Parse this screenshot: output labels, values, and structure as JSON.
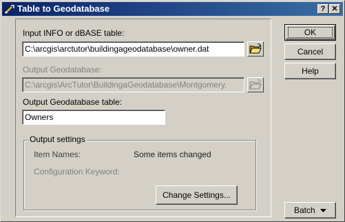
{
  "window": {
    "title": "Table to Geodatabase",
    "help_glyph": "?",
    "close_glyph": "✕"
  },
  "form": {
    "input_label": "Input INFO or dBASE table:",
    "input_value": "C:\\arcgis\\arctutor\\buildingageodatabase\\owner.dat",
    "output_gdb_label": "Output Geodatabase:",
    "output_gdb_value": "C:\\arcgis\\ArcTutor\\BuildingaGeodatabase\\Montgomery.",
    "output_table_label": "Output Geodatabase table:",
    "output_table_value": "Owners"
  },
  "output_settings": {
    "legend": "Output settings",
    "item_names_label": "Item Names:",
    "item_names_value": "Some items changed",
    "config_keyword_label": "Configuration Keyword:",
    "change_settings_label": "Change Settings..."
  },
  "buttons": {
    "ok": "OK",
    "cancel": "Cancel",
    "help": "Help",
    "batch": "Batch"
  },
  "icons": {
    "title_icon": "arcmap-tool-icon",
    "folder": "open-folder-icon",
    "dropdown": "triangle-down-icon"
  }
}
